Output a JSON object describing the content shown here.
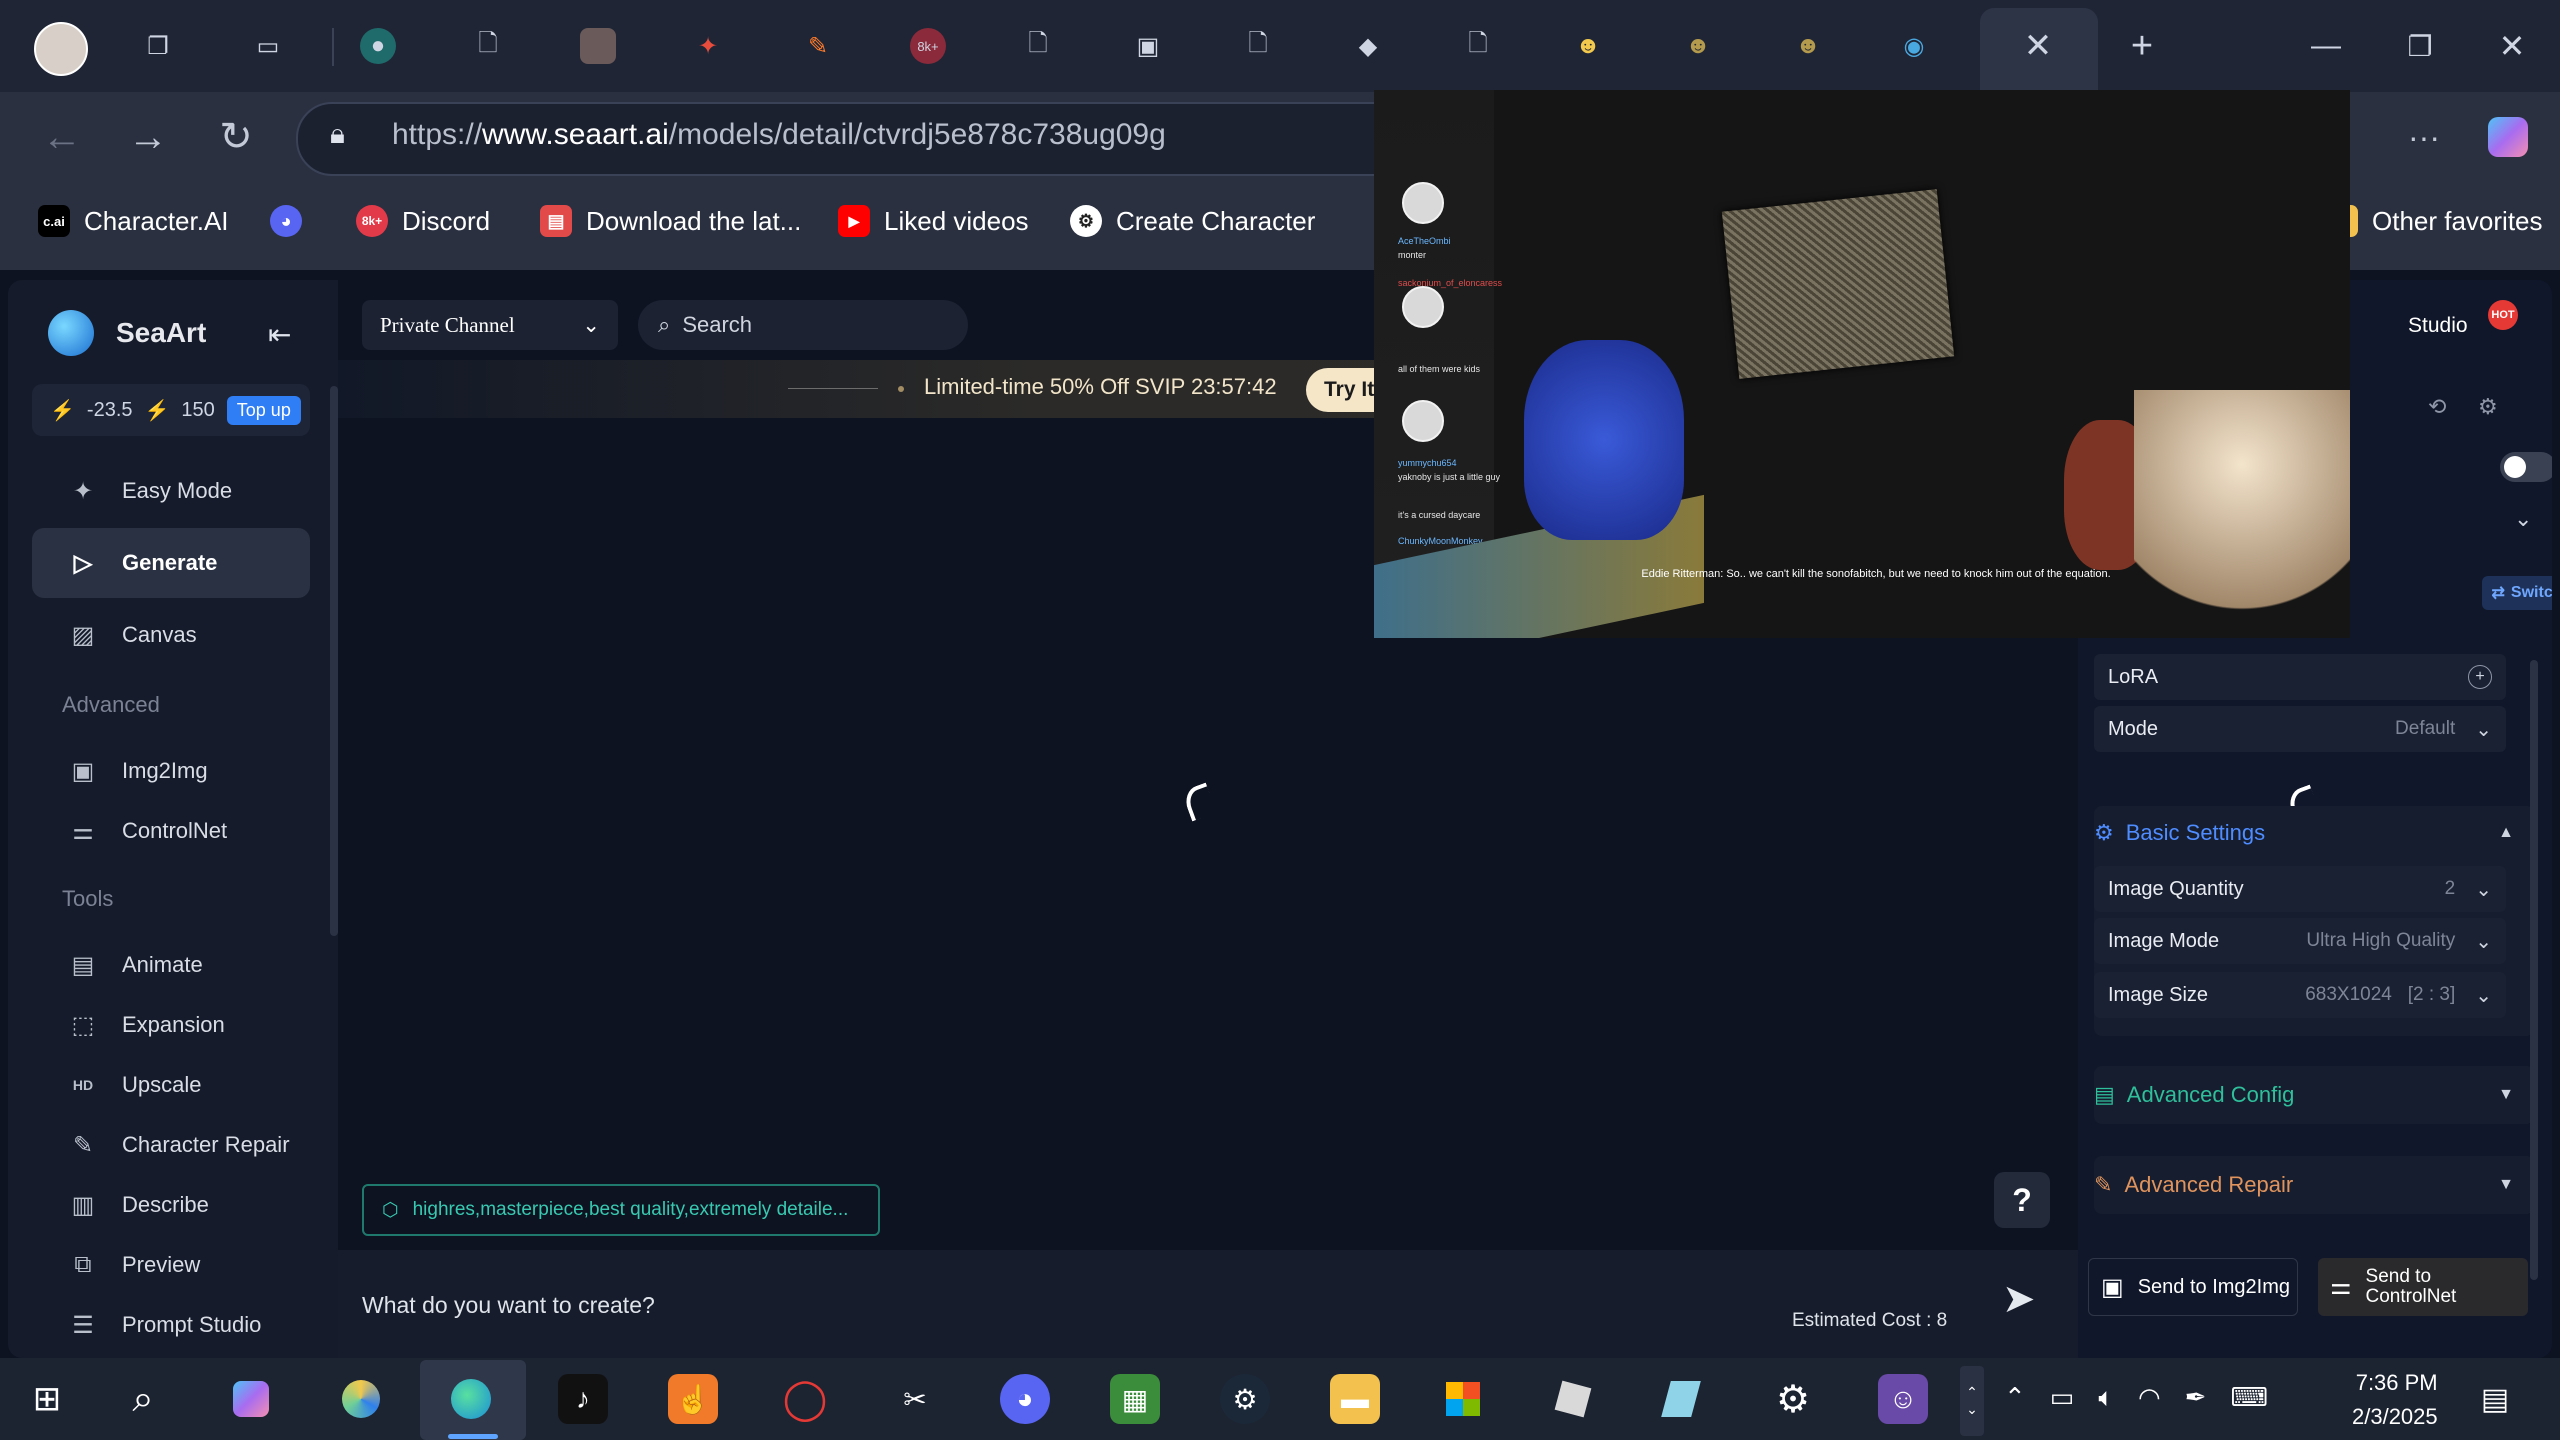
{
  "browser": {
    "url_prefix": "https://",
    "url_host": "www.seaart.ai",
    "url_path": "/models/detail/ctvrdj5e878c738ug09g",
    "favorites": [
      {
        "label": "Character.AI",
        "icon": "c.ai",
        "color": "#000000"
      },
      {
        "label": "",
        "icon": "discord-icon",
        "color": "#5865f2"
      },
      {
        "label": "Discord",
        "icon": "8k+",
        "color": "#e33a4a"
      },
      {
        "label": "Download the lat...",
        "icon": "box-icon",
        "color": "#e24a4a"
      },
      {
        "label": "Liked videos",
        "icon": "youtube-icon",
        "color": "#ff0000"
      },
      {
        "label": "Create Character",
        "icon": "openai-icon",
        "color": "#ffffff"
      }
    ],
    "other_favorites": "Other favorites"
  },
  "app": {
    "brand": "SeaArt",
    "credits": {
      "a": "-23.5",
      "b": "150",
      "topup": "Top up"
    },
    "nav": [
      {
        "label": "Easy Mode",
        "icon": "sparkle-icon"
      },
      {
        "label": "Generate",
        "icon": "play-icon"
      },
      {
        "label": "Canvas",
        "icon": "canvas-icon"
      }
    ],
    "section_advanced": "Advanced",
    "advanced": [
      {
        "label": "Img2Img",
        "icon": "image-icon"
      },
      {
        "label": "ControlNet",
        "icon": "sliders-icon"
      }
    ],
    "section_tools": "Tools",
    "tools": [
      {
        "label": "Animate",
        "icon": "film-icon"
      },
      {
        "label": "Expansion",
        "icon": "expand-icon"
      },
      {
        "label": "Upscale",
        "icon": "hd-icon"
      },
      {
        "label": "Character Repair",
        "icon": "wand-icon"
      },
      {
        "label": "Describe",
        "icon": "book-icon"
      },
      {
        "label": "Preview",
        "icon": "preview-icon"
      },
      {
        "label": "Prompt Studio",
        "icon": "list-icon"
      }
    ],
    "channel": "Private Channel",
    "search_placeholder": "Search",
    "promo": "Limited-time 50% Off SVIP 23:57:42",
    "promo_btn": "Try It",
    "tags": "highres,masterpiece,best quality,extremely detaile...",
    "prompt_placeholder": "What do you want to create?",
    "cost": "Estimated Cost : 8",
    "help": "?"
  },
  "right": {
    "studio": "Studio",
    "hot": "HOT",
    "switch": "Switch",
    "lora": "LoRA",
    "mode_label": "Mode",
    "mode_value": "Default",
    "basic_settings": "Basic Settings",
    "image_quantity": "Image Quantity",
    "image_quantity_val": "2",
    "image_mode": "Image Mode",
    "image_mode_val": "Ultra High Quality",
    "image_size": "Image Size",
    "image_size_val": "683X1024   [2 : 3]",
    "advanced_config": "Advanced Config",
    "advanced_repair": "Advanced Repair",
    "send_img2img": "Send to Img2Img",
    "send_controlnet_1": "Send to",
    "send_controlnet_2": "ControlNet",
    "accent": "#4f8cff"
  },
  "video": {
    "subtitle": "Eddie Ritterman:  So.. we can't kill the sonofabitch, but we need to knock him out of the equation.",
    "chat": [
      "AceTheOmbi",
      "monter",
      "sackonium_of_eloncaress",
      "all of them were kids",
      "yummychu654",
      "yaknoby is just a little guy",
      "it's a cursed daycare",
      "ChunkyMoonMonkey"
    ]
  },
  "taskbar": {
    "time": "7:36 PM",
    "date": "2/3/2025"
  }
}
